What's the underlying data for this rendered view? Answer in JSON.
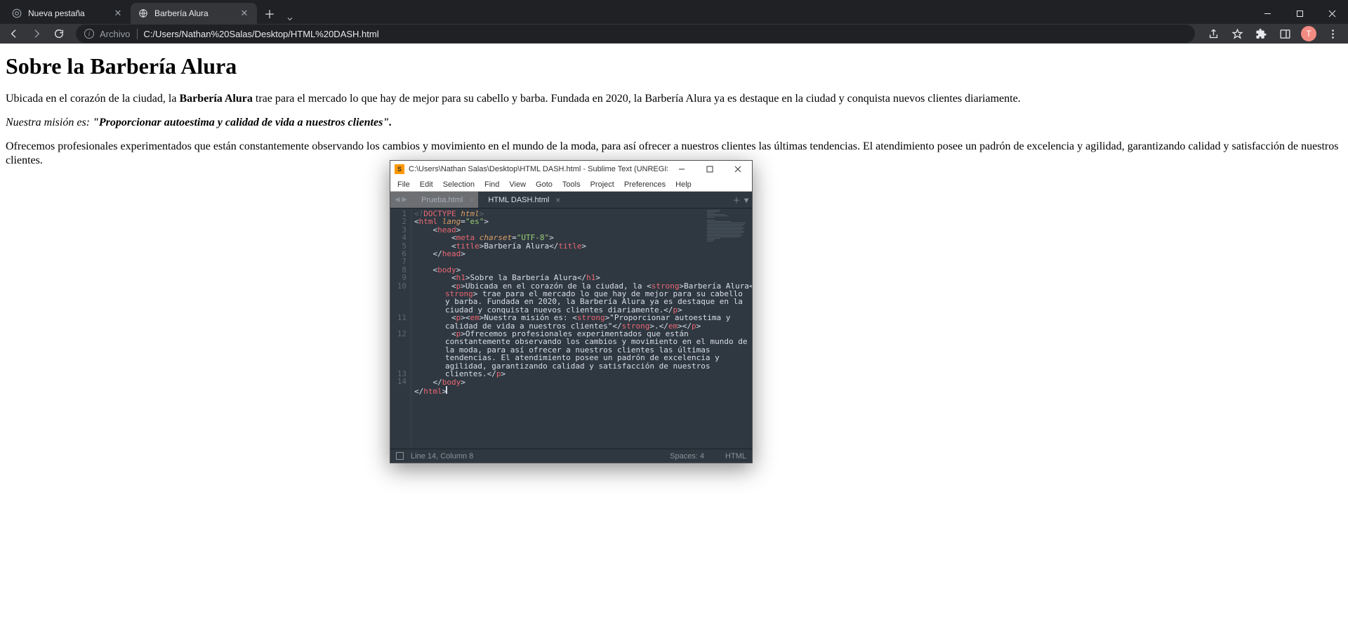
{
  "browser": {
    "tabs": [
      {
        "title": "Nueva pestaña",
        "active": false
      },
      {
        "title": "Barbería Alura",
        "active": true
      }
    ],
    "omnibox": {
      "label": "Archivo",
      "url": "C:/Users/Nathan%20Salas/Desktop/HTML%20DASH.html"
    },
    "avatar_letter": "T"
  },
  "page": {
    "h1": "Sobre la Barbería Alura",
    "p1_pre": "Ubicada en el corazón de la ciudad, la ",
    "p1_strong": "Barbería Alura",
    "p1_post": " trae para el mercado lo que hay de mejor para su cabello y barba. Fundada en 2020, la Barbería Alura ya es destaque en la ciudad y conquista nuevos clientes diariamente.",
    "p2_em_pre": "Nuestra misión es: ",
    "p2_strong": "\"Proporcionar autoestima y calidad de vida a nuestros clientes\".",
    "p3": "Ofrecemos profesionales experimentados que están constantemente observando los cambios y movimiento en el mundo de la moda, para así ofrecer a nuestros clientes las últimas tendencias. El atendimiento posee un padrón de excelencia y agilidad, garantizando calidad y satisfacción de nuestros clientes."
  },
  "sublime": {
    "title": "C:\\Users\\Nathan Salas\\Desktop\\HTML DASH.html - Sublime Text (UNREGISTERED)",
    "menus": [
      "File",
      "Edit",
      "Selection",
      "Find",
      "View",
      "Goto",
      "Tools",
      "Project",
      "Preferences",
      "Help"
    ],
    "tabs": [
      {
        "title": "Prueba.html",
        "active": false
      },
      {
        "title": "HTML DASH.html",
        "active": true
      }
    ],
    "line_numbers": [
      "1",
      "2",
      "3",
      "4",
      "5",
      "6",
      "7",
      "8",
      "9",
      "10",
      "",
      "",
      "",
      "11",
      "",
      "12",
      "",
      "",
      "",
      "",
      "13",
      "14"
    ],
    "status": {
      "cursor": "Line 14, Column 8",
      "spaces": "Spaces: 4",
      "syntax": "HTML"
    },
    "code": {
      "l1": {
        "a": "<!",
        "b": "DOCTYPE",
        "c": " html",
        "d": ">"
      },
      "l2": {
        "a": "<",
        "b": "html",
        "c": " lang",
        "d": "=",
        "e": "\"es\"",
        "f": ">"
      },
      "l3": {
        "a": "    <",
        "b": "head",
        "c": ">"
      },
      "l4": {
        "a": "        <",
        "b": "meta",
        "c": " charset",
        "d": "=",
        "e": "\"UTF-8\"",
        "f": ">"
      },
      "l5": {
        "a": "        <",
        "b": "title",
        "c": ">",
        "d": "Barbería Alura",
        "e": "</",
        "f": "title",
        "g": ">"
      },
      "l6": {
        "a": "    </",
        "b": "head",
        "c": ">"
      },
      "l8": {
        "a": "    <",
        "b": "body",
        "c": ">"
      },
      "l9": {
        "a": "        <",
        "b": "h1",
        "c": ">",
        "d": "Sobre la Barbería Alura",
        "e": "</",
        "f": "h1",
        "g": ">"
      },
      "l10a": {
        "a": "        <",
        "b": "p",
        "c": ">",
        "d": "Ubicada en el corazón de la ciudad, la ",
        "e": "<",
        "f": "strong",
        "g": ">",
        "h": "Barbería Alura",
        "i": "</"
      },
      "l10b": {
        "a": "strong",
        "b": ">",
        "c": " trae para el mercado lo que hay de mejor para su cabello"
      },
      "l10c": "y barba. Fundada en 2020, la Barbería Alura ya es destaque en la",
      "l10d": {
        "a": "ciudad y conquista nuevos clientes diariamente.",
        "b": "</",
        "c": "p",
        "d": ">"
      },
      "l11a": {
        "a": "        <",
        "b": "p",
        "c": "><",
        "d": "em",
        "e": ">",
        "f": "Nuestra misión es: ",
        "g": "<",
        "h": "strong",
        "i": ">",
        "j": "\"Proporcionar autoestima y"
      },
      "l11b": {
        "a": "calidad de vida a nuestros clientes\"",
        "b": "</",
        "c": "strong",
        "d": ">",
        "e": ".",
        "f": "</",
        "g": "em",
        "h": ">",
        "i": "</",
        "j": "p",
        "k": ">"
      },
      "l12a": {
        "a": "        <",
        "b": "p",
        "c": ">",
        "d": "Ofrecemos profesionales experimentados que están"
      },
      "l12b": "constantemente observando los cambios y movimiento en el mundo de",
      "l12c": "la moda, para así ofrecer a nuestros clientes las últimas",
      "l12d": "tendencias. El atendimiento posee un padrón de excelencia y",
      "l12e": "agilidad, garantizando calidad y satisfacción de nuestros",
      "l12f": {
        "a": "clientes.",
        "b": "</",
        "c": "p",
        "d": ">"
      },
      "l13": {
        "a": "    </",
        "b": "body",
        "c": ">"
      },
      "l14": {
        "a": "</",
        "b": "html",
        "c": ">"
      }
    }
  }
}
